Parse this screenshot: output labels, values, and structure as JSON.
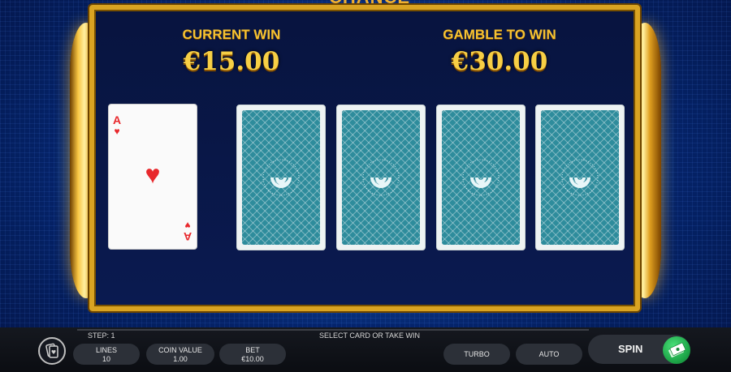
{
  "header": {
    "title_partial": "CHANCE"
  },
  "win": {
    "current_label": "CURRENT WIN",
    "current_value": "€15.00",
    "gamble_label": "GAMBLE TO WIN",
    "gamble_value": "€30.00"
  },
  "dealer_card": {
    "rank": "A",
    "suit": "hearts",
    "suit_glyph": "♥"
  },
  "choice_cards": [
    {
      "state": "face-down"
    },
    {
      "state": "face-down"
    },
    {
      "state": "face-down"
    },
    {
      "state": "face-down"
    }
  ],
  "bottom_bar": {
    "step": "STEP: 1",
    "message": "SELECT CARD OR TAKE WIN",
    "lines_label": "LINES",
    "lines_value": "10",
    "coin_label": "COIN VALUE",
    "coin_value": "1.00",
    "bet_label": "BET",
    "bet_value": "€10.00",
    "turbo_label": "TURBO",
    "auto_label": "AUTO",
    "spin_label": "SPIN"
  },
  "colors": {
    "gold": "#f6c232",
    "card_back": "#2e8c9c",
    "suit_red": "#e8282c",
    "spin_green": "#1fa84a"
  },
  "icons": {
    "menu": "cards-menu-icon",
    "spin": "cash-stack-icon"
  }
}
